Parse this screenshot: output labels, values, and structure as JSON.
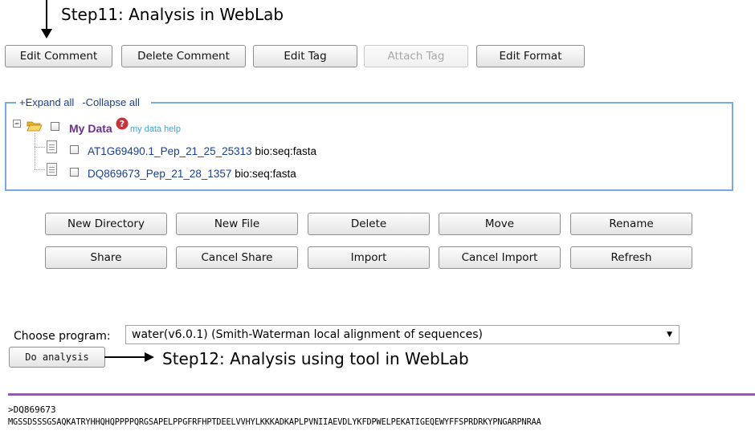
{
  "annotations": {
    "step11": "Step11: Analysis in WebLab",
    "step12": "Step12: Analysis using tool in WebLab"
  },
  "toolbar": {
    "edit_comment": "Edit Comment",
    "delete_comment": "Delete Comment",
    "edit_tag": "Edit Tag",
    "attach_tag": "Attach Tag",
    "edit_format": "Edit Format"
  },
  "tree": {
    "expand_all": "+Expand all",
    "collapse_all": "-Collapse all",
    "root_label": "My Data",
    "help_link": "my data help",
    "files": [
      {
        "name": "AT1G69490.1_Pep_21_25_25313",
        "type": "bio:seq:fasta"
      },
      {
        "name": "DQ869673_Pep_21_28_1357",
        "type": "bio:seq:fasta"
      }
    ]
  },
  "actions": {
    "new_directory": "New Directory",
    "new_file": "New File",
    "delete": "Delete",
    "move": "Move",
    "rename": "Rename",
    "share": "Share",
    "cancel_share": "Cancel Share",
    "import": "Import",
    "cancel_import": "Cancel Import",
    "refresh": "Refresh"
  },
  "program": {
    "label": "Choose program:",
    "selected": "water(v6.0.1) (Smith-Waterman local alignment of sequences)",
    "do_analysis": "Do analysis"
  },
  "sequence": {
    "header": ">DQ869673",
    "residues": "MGSSDSSSGSAQKATRYHHQHQPPPPQRGSAPELPPGFRFHPTDEELVVHYLKKKADKAPLPVNIIAEVDLYKFDPWELPEKATIGEQEWYFFSPRDRKYPNGARPNRAA"
  },
  "colors": {
    "tree_border": "#78a9e0",
    "link": "#1a3f8f",
    "root_label": "#6b2f8f",
    "help_link": "#39a7d6",
    "rule": "#8e5ca8"
  }
}
